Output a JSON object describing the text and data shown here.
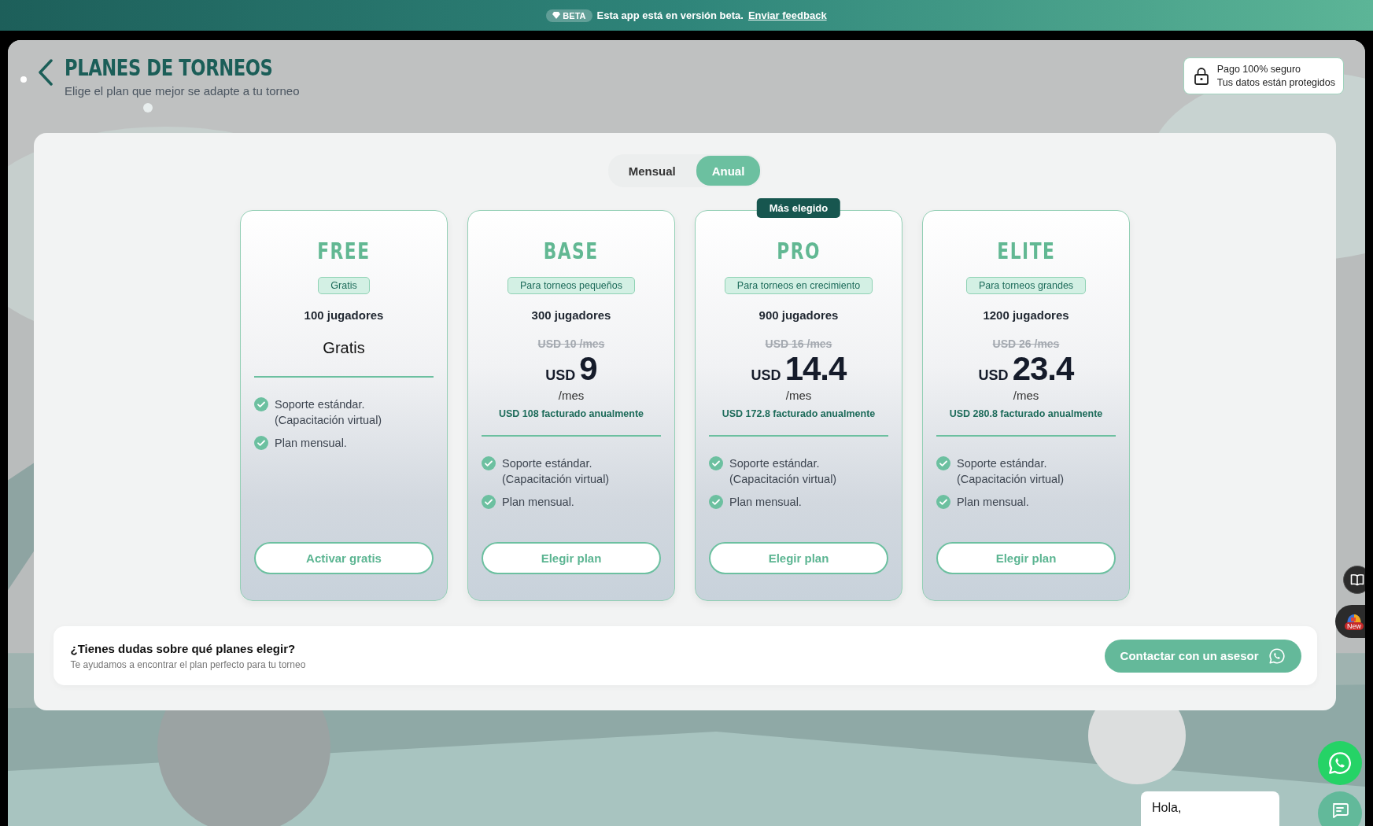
{
  "banner": {
    "badge": "BETA",
    "message": "Esta app está en versión beta.",
    "link": "Enviar feedback"
  },
  "header": {
    "title": "PLANES DE TORNEOS",
    "subtitle": "Elige el plan que mejor se adapte a tu torneo"
  },
  "secure_badge": {
    "title": "Pago 100% seguro",
    "subtitle": "Tus datos están protegidos"
  },
  "billing_toggle": [
    {
      "label": "Mensual",
      "selected": false
    },
    {
      "label": "Anual",
      "selected": true
    }
  ],
  "plans": [
    {
      "kind": "free",
      "name": "FREE",
      "tag": "Gratis",
      "players": "100 jugadores",
      "price_text": "Gratis",
      "features": [
        "Soporte estándar. (Capacitación virtual)",
        "Plan mensual."
      ],
      "button": "Activar gratis"
    },
    {
      "kind": "paid",
      "name": "BASE",
      "tag": "Para torneos pequeños",
      "players": "300 jugadores",
      "original_price": "USD 10 /mes",
      "currency": "USD",
      "price": "9",
      "period": "/mes",
      "billed": "USD 108 facturado anualmente",
      "features": [
        "Soporte estándar. (Capacitación virtual)",
        "Plan mensual."
      ],
      "button": "Elegir plan"
    },
    {
      "kind": "paid",
      "name": "PRO",
      "highlight": "Más elegido",
      "tag": "Para torneos en crecimiento",
      "players": "900 jugadores",
      "original_price": "USD 16 /mes",
      "currency": "USD",
      "price": "14.4",
      "period": "/mes",
      "billed": "USD 172.8 facturado anualmente",
      "features": [
        "Soporte estándar. (Capacitación virtual)",
        "Plan mensual."
      ],
      "button": "Elegir plan"
    },
    {
      "kind": "paid",
      "name": "ELITE",
      "tag": "Para torneos grandes",
      "players": "1200 jugadores",
      "original_price": "USD 26 /mes",
      "currency": "USD",
      "price": "23.4",
      "period": "/mes",
      "billed": "USD 280.8 facturado anualmente",
      "features": [
        "Soporte estándar. (Capacitación virtual)",
        "Plan mensual."
      ],
      "button": "Elegir plan"
    }
  ],
  "help": {
    "title": "¿Tienes dudas sobre qué planes elegir?",
    "subtitle": "Te ayudamos a encontrar el plan perfecto para tu torneo",
    "button": "Contactar con un asesor"
  },
  "side_widgets": {
    "new_badge": "New"
  },
  "chat": {
    "greeting": "Hola,"
  }
}
